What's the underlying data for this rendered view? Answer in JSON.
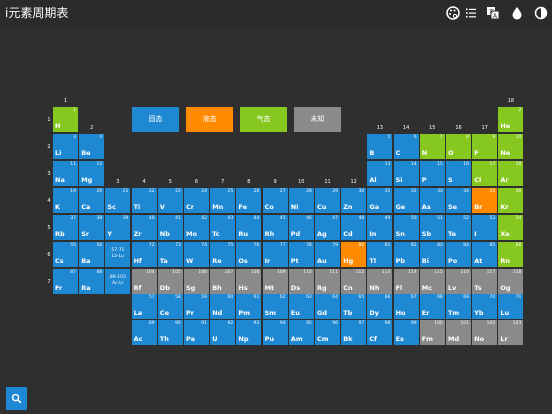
{
  "app": {
    "title": "i元素周期表"
  },
  "toolbar": {
    "icons": [
      "palette-icon",
      "list-icon",
      "translate-icon",
      "drop-icon",
      "contrast-icon"
    ]
  },
  "legend": {
    "solid": "固态",
    "liquid": "液态",
    "gas": "气态",
    "unknown": "未知"
  },
  "colors": {
    "solid": "#1e88d2",
    "liquid": "#ff8a00",
    "gas": "#86c820",
    "unknown": "#8a8a8a",
    "background": "#2f2f2f"
  },
  "group_numbers": [
    "1",
    "2",
    "3",
    "4",
    "5",
    "6",
    "7",
    "8",
    "9",
    "10",
    "11",
    "12",
    "13",
    "14",
    "15",
    "16",
    "17",
    "18"
  ],
  "period_numbers": [
    "1",
    "2",
    "3",
    "4",
    "5",
    "6",
    "7"
  ],
  "placeholders": [
    {
      "range": "57-71",
      "symbol": "La-Lu",
      "row": 6,
      "col": 3,
      "state": "solid"
    },
    {
      "range": "89-103",
      "symbol": "Ac-Lr",
      "row": 7,
      "col": 3,
      "state": "solid"
    }
  ],
  "elements": [
    {
      "n": "1",
      "s": "H",
      "r": 1,
      "c": 1,
      "t": "gas"
    },
    {
      "n": "2",
      "s": "He",
      "r": 1,
      "c": 18,
      "t": "gas"
    },
    {
      "n": "3",
      "s": "Li",
      "r": 2,
      "c": 1,
      "t": "solid"
    },
    {
      "n": "4",
      "s": "Be",
      "r": 2,
      "c": 2,
      "t": "solid"
    },
    {
      "n": "5",
      "s": "B",
      "r": 2,
      "c": 13,
      "t": "solid"
    },
    {
      "n": "6",
      "s": "C",
      "r": 2,
      "c": 14,
      "t": "solid"
    },
    {
      "n": "7",
      "s": "N",
      "r": 2,
      "c": 15,
      "t": "gas"
    },
    {
      "n": "8",
      "s": "O",
      "r": 2,
      "c": 16,
      "t": "gas"
    },
    {
      "n": "9",
      "s": "F",
      "r": 2,
      "c": 17,
      "t": "gas"
    },
    {
      "n": "10",
      "s": "Ne",
      "r": 2,
      "c": 18,
      "t": "gas"
    },
    {
      "n": "11",
      "s": "Na",
      "r": 3,
      "c": 1,
      "t": "solid"
    },
    {
      "n": "12",
      "s": "Mg",
      "r": 3,
      "c": 2,
      "t": "solid"
    },
    {
      "n": "13",
      "s": "Al",
      "r": 3,
      "c": 13,
      "t": "solid"
    },
    {
      "n": "14",
      "s": "Si",
      "r": 3,
      "c": 14,
      "t": "solid"
    },
    {
      "n": "15",
      "s": "P",
      "r": 3,
      "c": 15,
      "t": "solid"
    },
    {
      "n": "16",
      "s": "S",
      "r": 3,
      "c": 16,
      "t": "solid"
    },
    {
      "n": "17",
      "s": "Cl",
      "r": 3,
      "c": 17,
      "t": "gas"
    },
    {
      "n": "18",
      "s": "Ar",
      "r": 3,
      "c": 18,
      "t": "gas"
    },
    {
      "n": "19",
      "s": "K",
      "r": 4,
      "c": 1,
      "t": "solid"
    },
    {
      "n": "20",
      "s": "Ca",
      "r": 4,
      "c": 2,
      "t": "solid"
    },
    {
      "n": "21",
      "s": "Sc",
      "r": 4,
      "c": 3,
      "t": "solid"
    },
    {
      "n": "22",
      "s": "Ti",
      "r": 4,
      "c": 4,
      "t": "solid"
    },
    {
      "n": "23",
      "s": "V",
      "r": 4,
      "c": 5,
      "t": "solid"
    },
    {
      "n": "24",
      "s": "Cr",
      "r": 4,
      "c": 6,
      "t": "solid"
    },
    {
      "n": "25",
      "s": "Mn",
      "r": 4,
      "c": 7,
      "t": "solid"
    },
    {
      "n": "26",
      "s": "Fe",
      "r": 4,
      "c": 8,
      "t": "solid"
    },
    {
      "n": "27",
      "s": "Co",
      "r": 4,
      "c": 9,
      "t": "solid"
    },
    {
      "n": "28",
      "s": "Ni",
      "r": 4,
      "c": 10,
      "t": "solid"
    },
    {
      "n": "29",
      "s": "Cu",
      "r": 4,
      "c": 11,
      "t": "solid"
    },
    {
      "n": "30",
      "s": "Zn",
      "r": 4,
      "c": 12,
      "t": "solid"
    },
    {
      "n": "31",
      "s": "Ga",
      "r": 4,
      "c": 13,
      "t": "solid"
    },
    {
      "n": "32",
      "s": "Ge",
      "r": 4,
      "c": 14,
      "t": "solid"
    },
    {
      "n": "33",
      "s": "As",
      "r": 4,
      "c": 15,
      "t": "solid"
    },
    {
      "n": "34",
      "s": "Se",
      "r": 4,
      "c": 16,
      "t": "solid"
    },
    {
      "n": "35",
      "s": "Br",
      "r": 4,
      "c": 17,
      "t": "liquid"
    },
    {
      "n": "36",
      "s": "Kr",
      "r": 4,
      "c": 18,
      "t": "gas"
    },
    {
      "n": "37",
      "s": "Rb",
      "r": 5,
      "c": 1,
      "t": "solid"
    },
    {
      "n": "38",
      "s": "Sr",
      "r": 5,
      "c": 2,
      "t": "solid"
    },
    {
      "n": "39",
      "s": "Y",
      "r": 5,
      "c": 3,
      "t": "solid"
    },
    {
      "n": "40",
      "s": "Zr",
      "r": 5,
      "c": 4,
      "t": "solid"
    },
    {
      "n": "41",
      "s": "Nb",
      "r": 5,
      "c": 5,
      "t": "solid"
    },
    {
      "n": "42",
      "s": "Mo",
      "r": 5,
      "c": 6,
      "t": "solid"
    },
    {
      "n": "43",
      "s": "Tc",
      "r": 5,
      "c": 7,
      "t": "solid"
    },
    {
      "n": "44",
      "s": "Ru",
      "r": 5,
      "c": 8,
      "t": "solid"
    },
    {
      "n": "45",
      "s": "Rh",
      "r": 5,
      "c": 9,
      "t": "solid"
    },
    {
      "n": "46",
      "s": "Pd",
      "r": 5,
      "c": 10,
      "t": "solid"
    },
    {
      "n": "47",
      "s": "Ag",
      "r": 5,
      "c": 11,
      "t": "solid"
    },
    {
      "n": "48",
      "s": "Cd",
      "r": 5,
      "c": 12,
      "t": "solid"
    },
    {
      "n": "49",
      "s": "In",
      "r": 5,
      "c": 13,
      "t": "solid"
    },
    {
      "n": "50",
      "s": "Sn",
      "r": 5,
      "c": 14,
      "t": "solid"
    },
    {
      "n": "51",
      "s": "Sb",
      "r": 5,
      "c": 15,
      "t": "solid"
    },
    {
      "n": "52",
      "s": "Te",
      "r": 5,
      "c": 16,
      "t": "solid"
    },
    {
      "n": "53",
      "s": "I",
      "r": 5,
      "c": 17,
      "t": "solid"
    },
    {
      "n": "54",
      "s": "Xe",
      "r": 5,
      "c": 18,
      "t": "gas"
    },
    {
      "n": "55",
      "s": "Cs",
      "r": 6,
      "c": 1,
      "t": "solid"
    },
    {
      "n": "56",
      "s": "Ba",
      "r": 6,
      "c": 2,
      "t": "solid"
    },
    {
      "n": "72",
      "s": "Hf",
      "r": 6,
      "c": 4,
      "t": "solid"
    },
    {
      "n": "73",
      "s": "Ta",
      "r": 6,
      "c": 5,
      "t": "solid"
    },
    {
      "n": "74",
      "s": "W",
      "r": 6,
      "c": 6,
      "t": "solid"
    },
    {
      "n": "75",
      "s": "Re",
      "r": 6,
      "c": 7,
      "t": "solid"
    },
    {
      "n": "76",
      "s": "Os",
      "r": 6,
      "c": 8,
      "t": "solid"
    },
    {
      "n": "77",
      "s": "Ir",
      "r": 6,
      "c": 9,
      "t": "solid"
    },
    {
      "n": "78",
      "s": "Pt",
      "r": 6,
      "c": 10,
      "t": "solid"
    },
    {
      "n": "79",
      "s": "Au",
      "r": 6,
      "c": 11,
      "t": "solid"
    },
    {
      "n": "80",
      "s": "Hg",
      "r": 6,
      "c": 12,
      "t": "liquid"
    },
    {
      "n": "81",
      "s": "Tl",
      "r": 6,
      "c": 13,
      "t": "solid"
    },
    {
      "n": "82",
      "s": "Pb",
      "r": 6,
      "c": 14,
      "t": "solid"
    },
    {
      "n": "83",
      "s": "Bi",
      "r": 6,
      "c": 15,
      "t": "solid"
    },
    {
      "n": "84",
      "s": "Po",
      "r": 6,
      "c": 16,
      "t": "solid"
    },
    {
      "n": "85",
      "s": "At",
      "r": 6,
      "c": 17,
      "t": "solid"
    },
    {
      "n": "86",
      "s": "Rn",
      "r": 6,
      "c": 18,
      "t": "gas"
    },
    {
      "n": "87",
      "s": "Fr",
      "r": 7,
      "c": 1,
      "t": "solid"
    },
    {
      "n": "88",
      "s": "Ra",
      "r": 7,
      "c": 2,
      "t": "solid"
    },
    {
      "n": "104",
      "s": "Rf",
      "r": 7,
      "c": 4,
      "t": "unknown"
    },
    {
      "n": "105",
      "s": "Db",
      "r": 7,
      "c": 5,
      "t": "unknown"
    },
    {
      "n": "106",
      "s": "Sg",
      "r": 7,
      "c": 6,
      "t": "unknown"
    },
    {
      "n": "107",
      "s": "Bh",
      "r": 7,
      "c": 7,
      "t": "unknown"
    },
    {
      "n": "108",
      "s": "Hs",
      "r": 7,
      "c": 8,
      "t": "unknown"
    },
    {
      "n": "109",
      "s": "Mt",
      "r": 7,
      "c": 9,
      "t": "unknown"
    },
    {
      "n": "110",
      "s": "Ds",
      "r": 7,
      "c": 10,
      "t": "unknown"
    },
    {
      "n": "111",
      "s": "Rg",
      "r": 7,
      "c": 11,
      "t": "unknown"
    },
    {
      "n": "112",
      "s": "Cn",
      "r": 7,
      "c": 12,
      "t": "unknown"
    },
    {
      "n": "113",
      "s": "Nh",
      "r": 7,
      "c": 13,
      "t": "unknown"
    },
    {
      "n": "114",
      "s": "Fl",
      "r": 7,
      "c": 14,
      "t": "unknown"
    },
    {
      "n": "115",
      "s": "Mc",
      "r": 7,
      "c": 15,
      "t": "unknown"
    },
    {
      "n": "116",
      "s": "Lv",
      "r": 7,
      "c": 16,
      "t": "unknown"
    },
    {
      "n": "117",
      "s": "Ts",
      "r": 7,
      "c": 17,
      "t": "unknown"
    },
    {
      "n": "118",
      "s": "Og",
      "r": 7,
      "c": 18,
      "t": "unknown"
    },
    {
      "n": "57",
      "s": "La",
      "r": 9,
      "c": 4,
      "t": "solid"
    },
    {
      "n": "58",
      "s": "Ce",
      "r": 9,
      "c": 5,
      "t": "solid"
    },
    {
      "n": "59",
      "s": "Pr",
      "r": 9,
      "c": 6,
      "t": "solid"
    },
    {
      "n": "60",
      "s": "Nd",
      "r": 9,
      "c": 7,
      "t": "solid"
    },
    {
      "n": "61",
      "s": "Pm",
      "r": 9,
      "c": 8,
      "t": "solid"
    },
    {
      "n": "62",
      "s": "Sm",
      "r": 9,
      "c": 9,
      "t": "solid"
    },
    {
      "n": "63",
      "s": "Eu",
      "r": 9,
      "c": 10,
      "t": "solid"
    },
    {
      "n": "64",
      "s": "Gd",
      "r": 9,
      "c": 11,
      "t": "solid"
    },
    {
      "n": "65",
      "s": "Tb",
      "r": 9,
      "c": 12,
      "t": "solid"
    },
    {
      "n": "66",
      "s": "Dy",
      "r": 9,
      "c": 13,
      "t": "solid"
    },
    {
      "n": "67",
      "s": "Ho",
      "r": 9,
      "c": 14,
      "t": "solid"
    },
    {
      "n": "68",
      "s": "Er",
      "r": 9,
      "c": 15,
      "t": "solid"
    },
    {
      "n": "69",
      "s": "Tm",
      "r": 9,
      "c": 16,
      "t": "solid"
    },
    {
      "n": "70",
      "s": "Yb",
      "r": 9,
      "c": 17,
      "t": "solid"
    },
    {
      "n": "71",
      "s": "Lu",
      "r": 9,
      "c": 18,
      "t": "solid"
    },
    {
      "n": "89",
      "s": "Ac",
      "r": 10,
      "c": 4,
      "t": "solid"
    },
    {
      "n": "90",
      "s": "Th",
      "r": 10,
      "c": 5,
      "t": "solid"
    },
    {
      "n": "91",
      "s": "Pa",
      "r": 10,
      "c": 6,
      "t": "solid"
    },
    {
      "n": "92",
      "s": "U",
      "r": 10,
      "c": 7,
      "t": "solid"
    },
    {
      "n": "93",
      "s": "Np",
      "r": 10,
      "c": 8,
      "t": "solid"
    },
    {
      "n": "94",
      "s": "Pu",
      "r": 10,
      "c": 9,
      "t": "solid"
    },
    {
      "n": "95",
      "s": "Am",
      "r": 10,
      "c": 10,
      "t": "solid"
    },
    {
      "n": "96",
      "s": "Cm",
      "r": 10,
      "c": 11,
      "t": "solid"
    },
    {
      "n": "97",
      "s": "Bk",
      "r": 10,
      "c": 12,
      "t": "solid"
    },
    {
      "n": "98",
      "s": "Cf",
      "r": 10,
      "c": 13,
      "t": "solid"
    },
    {
      "n": "99",
      "s": "Es",
      "r": 10,
      "c": 14,
      "t": "solid"
    },
    {
      "n": "100",
      "s": "Fm",
      "r": 10,
      "c": 15,
      "t": "unknown"
    },
    {
      "n": "101",
      "s": "Md",
      "r": 10,
      "c": 16,
      "t": "unknown"
    },
    {
      "n": "102",
      "s": "No",
      "r": 10,
      "c": 17,
      "t": "unknown"
    },
    {
      "n": "103",
      "s": "Lr",
      "r": 10,
      "c": 18,
      "t": "unknown"
    }
  ]
}
